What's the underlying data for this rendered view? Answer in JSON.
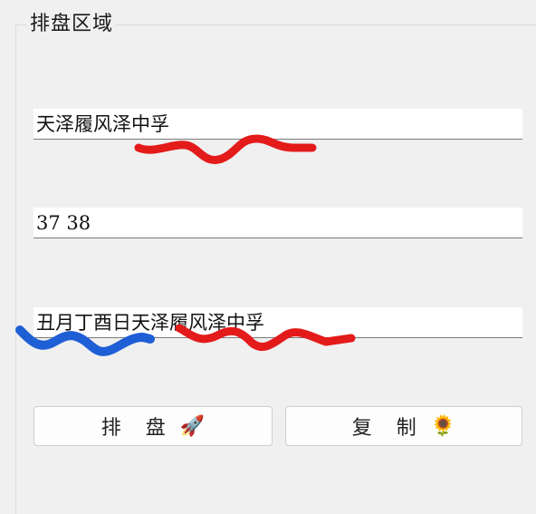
{
  "group": {
    "title": "排盘区域"
  },
  "fields": {
    "hexagram": "天泽履风泽中孚",
    "numbers": "37 38",
    "date_hexagram": "丑月丁酉日天泽履风泽中孚"
  },
  "buttons": {
    "paipan_label": "排 盘",
    "paipan_icon": "🚀",
    "copy_label": "复 制",
    "copy_icon": "🌻"
  },
  "colors": {
    "scribble_red": "#e41b1b",
    "scribble_blue": "#1f5fd6"
  }
}
